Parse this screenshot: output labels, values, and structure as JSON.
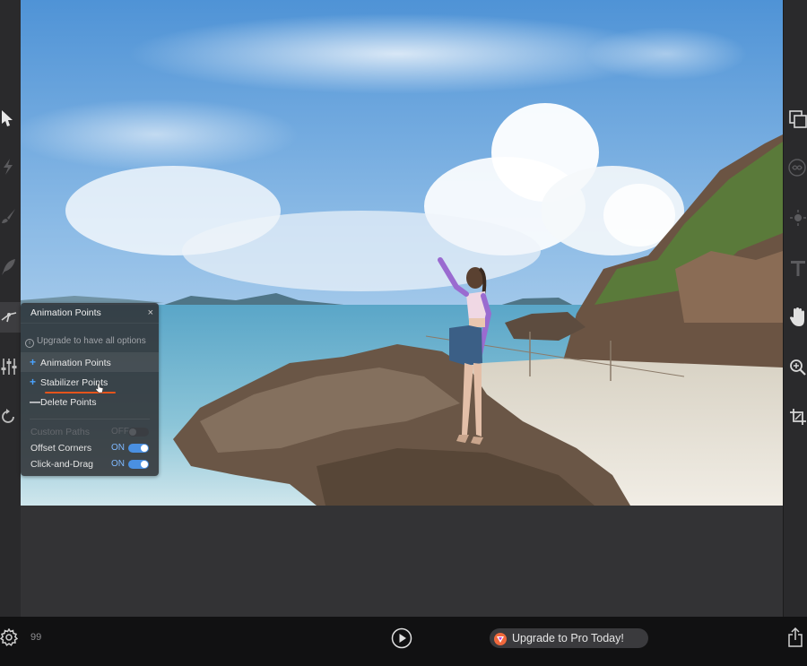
{
  "panel": {
    "title": "Animation Points",
    "close": "×",
    "upgrade_note": "Upgrade to have all options",
    "items": [
      {
        "symbol": "+",
        "label": "Animation Points"
      },
      {
        "symbol": "+",
        "label": "Stabilizer Points"
      },
      {
        "symbol": "—",
        "label": "Delete Points"
      }
    ],
    "options": [
      {
        "label": "Custom Paths",
        "state": "OFF",
        "enabled": false
      },
      {
        "label": "Offset Corners",
        "state": "ON",
        "enabled": true
      },
      {
        "label": "Click-and-Drag",
        "state": "ON",
        "enabled": true
      }
    ]
  },
  "bottom_bar": {
    "frame_count": "99",
    "upgrade_button": "Upgrade to Pro Today!"
  },
  "icons": {
    "left_toolbar": [
      "cursor-icon",
      "lightning-icon",
      "brush-icon",
      "feather-icon",
      "path-icon",
      "sliders-icon",
      "loop-icon"
    ],
    "right_toolbar": [
      "layers-icon",
      "infinity-icon",
      "sun-icon",
      "text-icon",
      "hand-icon",
      "zoom-icon",
      "crop-icon"
    ],
    "bottom": [
      "gear-icon",
      "play-icon",
      "pro-logo-icon",
      "share-icon"
    ]
  },
  "colors": {
    "accent_blue": "#4a90e2",
    "underline_orange": "#e5541c",
    "panel_bg": "#303236",
    "toolbar_bg": "#2a2a2c",
    "bottom_bar_bg": "#111112"
  }
}
